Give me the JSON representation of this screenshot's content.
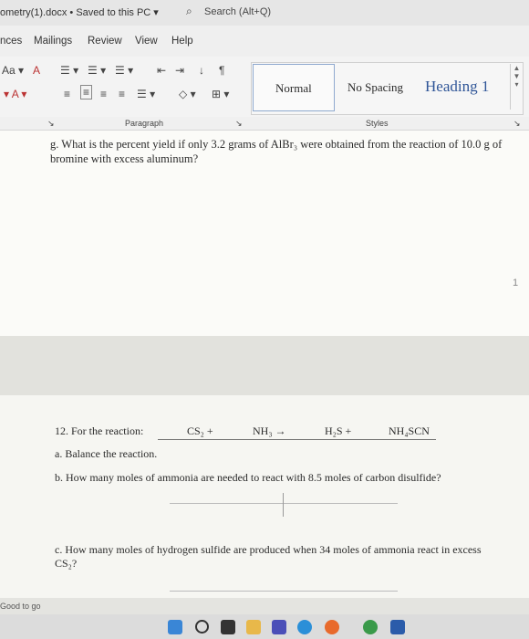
{
  "titlebar": {
    "document_title": "ometry(1).docx • Saved to this PC ▾",
    "search_placeholder": "Search (Alt+Q)"
  },
  "menu": {
    "items": [
      "nces",
      "Mailings",
      "Review",
      "View",
      "Help"
    ]
  },
  "styles": {
    "normal": "Normal",
    "no_spacing": "No Spacing",
    "heading1": "Heading 1"
  },
  "group_labels": {
    "paragraph": "Paragraph",
    "styles": "Styles"
  },
  "page1": {
    "question_g": "g.  What is the percent yield if only 3.2 grams of AlBr₃ were obtained from the reaction of 10.0 g of bromine with excess aluminum?",
    "page_number": "1"
  },
  "page2": {
    "q12_intro": "12.  For the reaction:",
    "eq_cs2": "CS₂  +",
    "eq_nh3": "NH₃  →",
    "eq_h2s": "H₂S  +",
    "eq_nh4scn": "NH₄SCN",
    "part_a": "a.  Balance the reaction.",
    "part_b": "b.  How many moles of ammonia are needed to react with 8.5 moles of carbon disulfide?",
    "part_c": "c.  How many moles of hydrogen sulfide are produced when 34 moles of ammonia react in excess CS₂?"
  },
  "status": {
    "text": "Good to go"
  },
  "colors": {
    "heading_blue": "#2f5597",
    "selected_style_border": "#8fa9cf"
  }
}
